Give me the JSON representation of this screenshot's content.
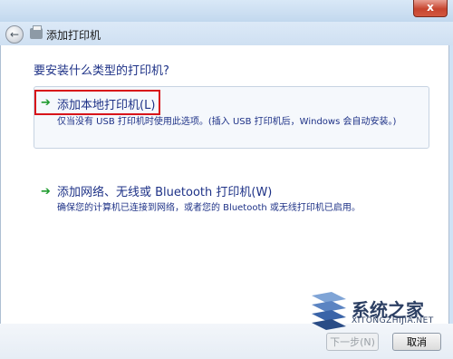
{
  "window": {
    "close_label": "x"
  },
  "header": {
    "title": "添加打印机"
  },
  "question": "要安装什么类型的打印机?",
  "options": [
    {
      "title": "添加本地打印机(L)",
      "description": "仅当没有 USB 打印机时使用此选项。(插入 USB 打印机后，Windows 会自动安装。)"
    },
    {
      "title": "添加网络、无线或 Bluetooth 打印机(W)",
      "description": "确保您的计算机已连接到网络，或者您的 Bluetooth 或无线打印机已启用。"
    }
  ],
  "footer": {
    "next_label": "下一步(N)",
    "cancel_label": "取消"
  },
  "watermark": {
    "brand": "系统之家",
    "url": "XITONGZHIJIA.NET"
  },
  "colors": {
    "link": "#1e3287",
    "highlight_border": "#d8141a",
    "arrow": "#1f9b2e"
  }
}
